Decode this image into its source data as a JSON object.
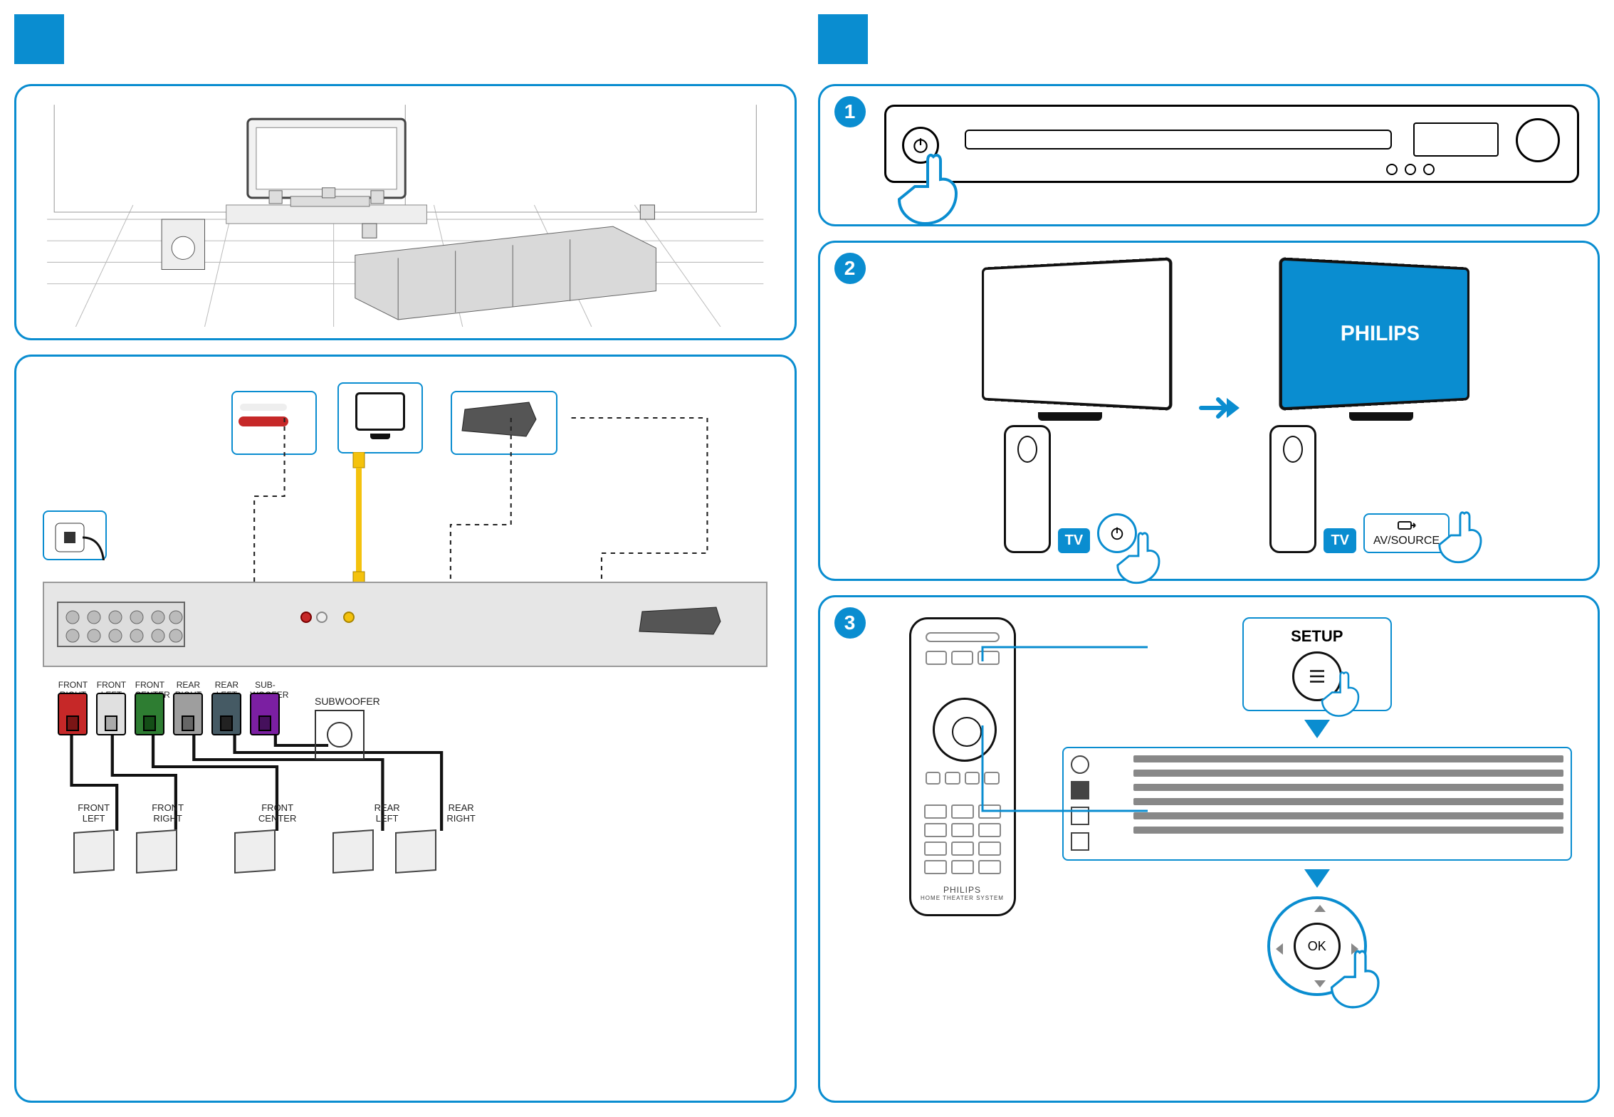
{
  "brand": "PHILIPS",
  "left": {
    "speaker_conn_labels": [
      "FRONT RIGHT",
      "FRONT LEFT",
      "FRONT CENTER",
      "REAR RIGHT",
      "REAR LEFT",
      "SUB-WOOFER"
    ],
    "speaker_conn_colors": [
      "#c62828",
      "#e0e0e0",
      "#2e7d32",
      "#9e9e9e",
      "#455a64",
      "#7b1fa2"
    ],
    "subwoofer_label": "SUBWOOFER",
    "speaker_labels": [
      "FRONT LEFT",
      "FRONT RIGHT",
      "FRONT CENTER",
      "REAR LEFT",
      "REAR RIGHT"
    ]
  },
  "right": {
    "steps": [
      "1",
      "2",
      "3"
    ],
    "tv_badge": "TV",
    "av_source": "AV/SOURCE",
    "setup_label": "SETUP",
    "ok_label": "OK",
    "remote_brand": "PHILIPS",
    "remote_sub": "HOME THEATER SYSTEM"
  }
}
